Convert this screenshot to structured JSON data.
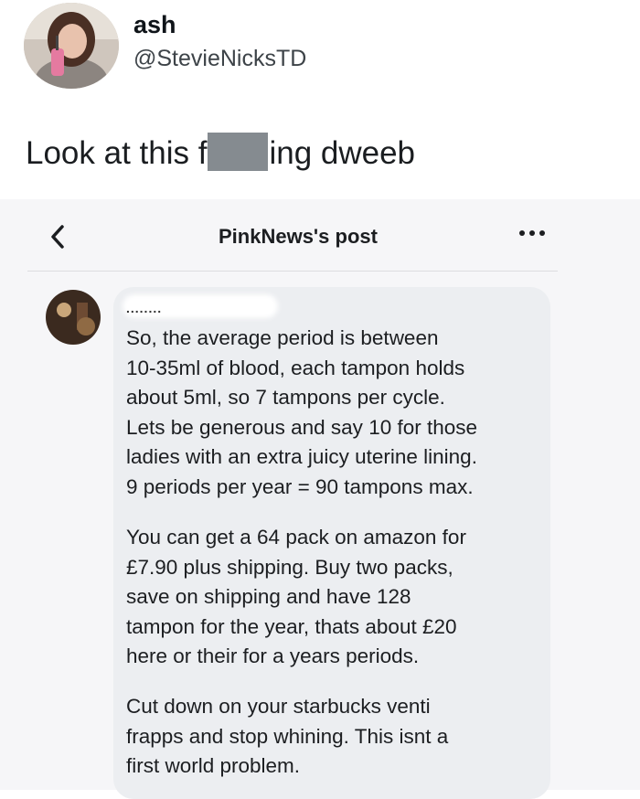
{
  "tweet": {
    "display_name": "ash",
    "handle": "@StevieNicksTD",
    "text_before": "Look at this f",
    "text_after": "ing dweeb"
  },
  "embedded_post": {
    "title": "PinkNews's post",
    "back_icon": "chevron-left-icon",
    "more_icon": "more-horizontal-icon",
    "comment": {
      "author_redacted": "........",
      "paragraphs": [
        "So, the average period is between\n10-35ml of blood, each tampon holds\nabout 5ml, so 7 tampons per cycle.\nLets be generous and say 10 for those\nladies with an extra juicy uterine lining.\n9 periods per year = 90 tampons max.",
        "You can get a 64 pack on amazon for\n£7.90 plus shipping. Buy two packs,\nsave on shipping and have 128\ntampon for the year, thats about £20\nhere or their for a years periods.",
        "Cut down on your starbucks venti\nfrapps and stop whining. This isnt a\nfirst world problem."
      ]
    }
  }
}
